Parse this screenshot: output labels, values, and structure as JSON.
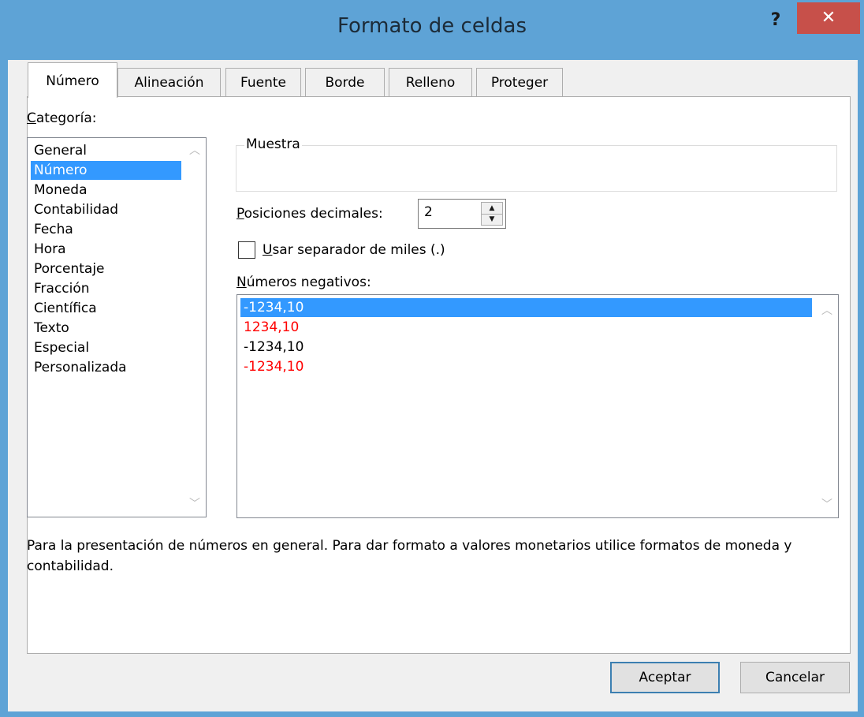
{
  "window": {
    "title": "Formato de celdas",
    "help_glyph": "?",
    "close_glyph": "✕"
  },
  "tabs": [
    {
      "label": "Número",
      "active": true
    },
    {
      "label": "Alineación",
      "active": false
    },
    {
      "label": "Fuente",
      "active": false
    },
    {
      "label": "Borde",
      "active": false
    },
    {
      "label": "Relleno",
      "active": false
    },
    {
      "label": "Proteger",
      "active": false
    }
  ],
  "category": {
    "label_mnemonic": "C",
    "label_rest": "ategoría:",
    "items": [
      "General",
      "Número",
      "Moneda",
      "Contabilidad",
      "Fecha",
      "Hora",
      "Porcentaje",
      "Fracción",
      "Científica",
      "Texto",
      "Especial",
      "Personalizada"
    ],
    "selected": "Número"
  },
  "sample": {
    "label": "Muestra",
    "value": ""
  },
  "decimals": {
    "label_mnemonic": "P",
    "label_rest": "osiciones decimales:",
    "value": "2"
  },
  "thousands": {
    "label_mnemonic": "U",
    "label_rest": "sar separador de miles (.)",
    "checked": false
  },
  "negatives": {
    "label_mnemonic": "N",
    "label_rest": "úmeros negativos:",
    "items": [
      {
        "text": "-1234,10",
        "color": "#000000",
        "selected": true
      },
      {
        "text": "1234,10",
        "color": "#ff0000",
        "selected": false
      },
      {
        "text": "-1234,10",
        "color": "#000000",
        "selected": false
      },
      {
        "text": "-1234,10",
        "color": "#ff0000",
        "selected": false
      }
    ]
  },
  "description": "Para la presentación de números en general. Para dar formato a valores monetarios utilice formatos de moneda y contabilidad.",
  "buttons": {
    "ok": "Aceptar",
    "cancel": "Cancelar"
  },
  "colors": {
    "titlebar": "#5ea3d6",
    "close": "#c7504a",
    "selection": "#3399ff",
    "negative_red": "#ff0000"
  }
}
